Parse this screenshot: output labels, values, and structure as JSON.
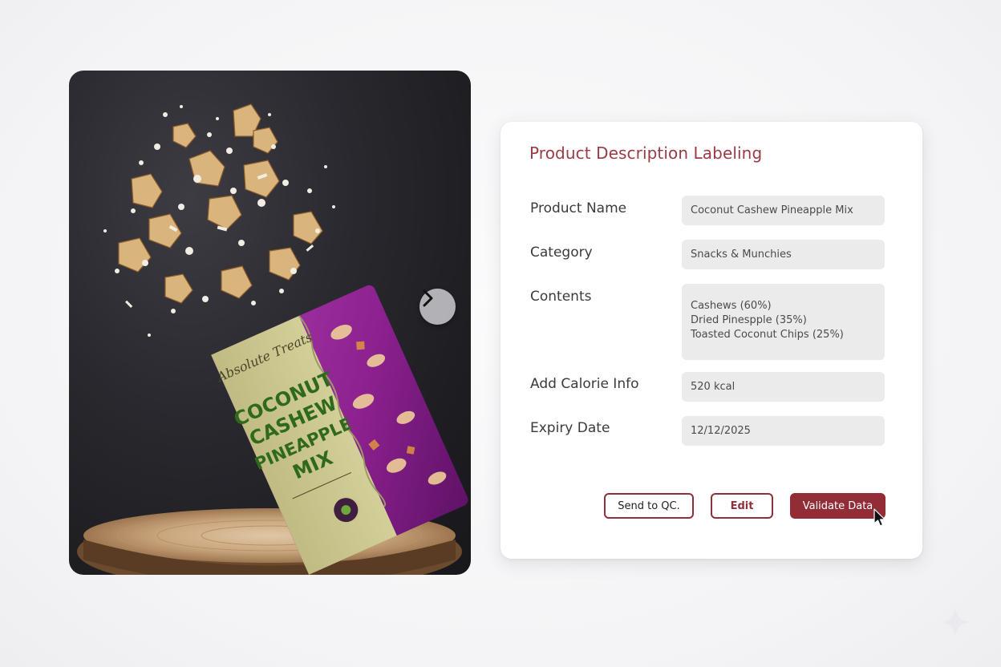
{
  "form": {
    "title": "Product Description Labeling",
    "fields": [
      {
        "label": "Product Name",
        "value": "Coconut Cashew Pineapple Mix"
      },
      {
        "label": "Category",
        "value": "Snacks & Munchies"
      },
      {
        "label": "Contents",
        "lines": [
          "Cashews (60%)",
          "Dried Pinespple (35%)",
          "Toasted Coconut Chips (25%)"
        ]
      },
      {
        "label": "Add Calorie Info",
        "value": "520 kcal"
      },
      {
        "label": "Expiry Date",
        "value": "12/12/2025"
      }
    ],
    "buttons": {
      "send_qc": "Send to QC.",
      "edit": "Edit",
      "validate": "Validate Data"
    }
  },
  "product_image": {
    "package_text": [
      "COCONUT",
      "CASHEW",
      "PINEAPPLE",
      "MIX"
    ],
    "brand_script": "Absolute Treats",
    "next_icon": "chevron-right-icon"
  },
  "colors": {
    "accent": "#922c37",
    "title": "#9c3a44",
    "field_bg": "#ebebec",
    "package_purple": "#8a1f8c",
    "package_label": "#c9c58e"
  }
}
